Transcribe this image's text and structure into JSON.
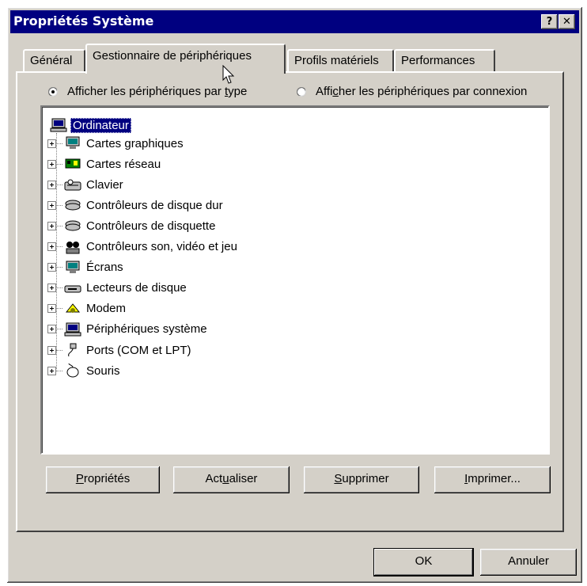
{
  "window": {
    "title": "Propriétés Système",
    "help_btn": "?",
    "close_btn": "✕"
  },
  "tabs": [
    {
      "label": "Général"
    },
    {
      "label": "Gestionnaire de périphériques"
    },
    {
      "label": "Profils matériels"
    },
    {
      "label": "Performances"
    }
  ],
  "view_options": {
    "by_type": {
      "pre": "Afficher les périphériques par ",
      "accel": "t",
      "post": "ype"
    },
    "by_connection": {
      "pre": "Affi",
      "accel": "c",
      "post": "her les périphériques par connexion"
    }
  },
  "tree": {
    "root": "Ordinateur",
    "items": [
      {
        "label": "Cartes graphiques",
        "icon": "monitor-icon"
      },
      {
        "label": "Cartes réseau",
        "icon": "network-card-icon"
      },
      {
        "label": "Clavier",
        "icon": "keyboard-icon"
      },
      {
        "label": "Contrôleurs de disque dur",
        "icon": "disk-controller-icon"
      },
      {
        "label": "Contrôleurs de disquette",
        "icon": "floppy-controller-icon"
      },
      {
        "label": "Contrôleurs son, vidéo et jeu",
        "icon": "sound-video-game-icon"
      },
      {
        "label": "Écrans",
        "icon": "monitor-icon"
      },
      {
        "label": "Lecteurs de disque",
        "icon": "disk-drive-icon"
      },
      {
        "label": "Modem",
        "icon": "modem-icon"
      },
      {
        "label": "Périphériques système",
        "icon": "system-device-icon"
      },
      {
        "label": "Ports (COM et LPT)",
        "icon": "port-icon"
      },
      {
        "label": "Souris",
        "icon": "mouse-icon"
      }
    ]
  },
  "buttons": {
    "properties": {
      "accel": "P",
      "post": "ropriétés"
    },
    "refresh": {
      "pre": "Act",
      "accel": "u",
      "post": "aliser"
    },
    "remove": {
      "accel": "S",
      "post": "upprimer"
    },
    "print": {
      "accel": "I",
      "post": "mprimer..."
    },
    "ok": "OK",
    "cancel": "Annuler"
  },
  "colors": {
    "titlebar": "#000080",
    "face": "#d4d0c8",
    "selection": "#000080"
  }
}
